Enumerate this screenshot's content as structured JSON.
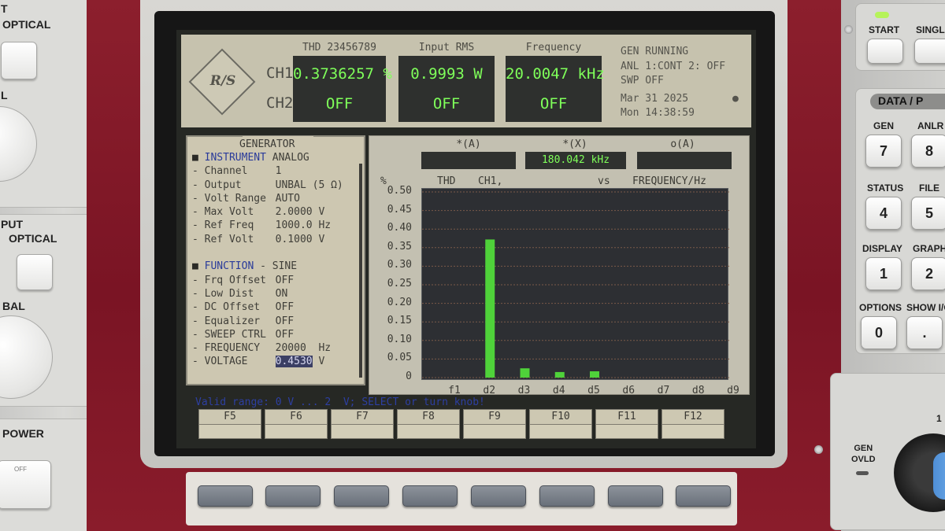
{
  "left_panel": {
    "top_label_partial": "T",
    "optical_label_1": "OPTICAL",
    "l_label": "L",
    "put_label": "PUT",
    "optical_label_2": "OPTICAL",
    "bal_label": "BAL",
    "power_label": "POWER",
    "off_label": "OFF"
  },
  "right_panel": {
    "start_label": "START",
    "single_label": "SINGLE",
    "data_label": "DATA / P",
    "keys": [
      {
        "label": "GEN",
        "digit": "7"
      },
      {
        "label": "ANLR",
        "digit": "8"
      },
      {
        "label": "STATUS",
        "digit": "4"
      },
      {
        "label": "FILE",
        "digit": "5"
      },
      {
        "label": "DISPLAY",
        "digit": "1"
      },
      {
        "label": "GRAPH",
        "digit": "2"
      }
    ],
    "options_label": "OPTIONS",
    "show_io_label": "SHOW I/O",
    "key_0": "0",
    "key_dot": ".",
    "gen_ovld_label": "GEN\nOVLD",
    "one_label": "1"
  },
  "header": {
    "ch1_label": "CH1",
    "ch2_label": "CH2",
    "measurements": [
      {
        "title": "THD 23456789",
        "ch1": "0.3736257 %",
        "ch2": "OFF"
      },
      {
        "title": "Input RMS",
        "ch1": "0.9993  W",
        "ch2": "OFF"
      },
      {
        "title": "Frequency",
        "ch1": "20.0047 kHz",
        "ch2": "OFF"
      }
    ],
    "status": {
      "line1": "GEN RUNNING",
      "line2": "ANL 1:CONT 2: OFF",
      "line3": "SWP OFF",
      "line4": "Mar 31 2025",
      "line5": "Mon 14:38:59",
      "indicator": "●"
    },
    "logo_text": "R/S"
  },
  "generator": {
    "title": "GENERATOR",
    "instrument_label": "INSTRUMENT",
    "instrument_value": "ANALOG",
    "rows1": [
      {
        "label": "Channel",
        "value": "1"
      },
      {
        "label": "Output",
        "value": "UNBAL (5 Ω)"
      },
      {
        "label": "Volt Range",
        "value": "AUTO"
      },
      {
        "label": "Max Volt",
        "value": "2.0000 V"
      },
      {
        "label": "Ref Freq",
        "value": "1000.0 Hz"
      },
      {
        "label": "Ref Volt",
        "value": "0.1000 V"
      }
    ],
    "function_label": "FUNCTION",
    "function_value": "- SINE",
    "rows2": [
      {
        "label": "Frq Offset",
        "value": "OFF"
      },
      {
        "label": "Low Dist",
        "value": "ON"
      },
      {
        "label": "DC Offset",
        "value": "OFF"
      },
      {
        "label": "Equalizer",
        "value": "OFF"
      },
      {
        "label": "SWEEP CTRL",
        "value": "OFF"
      },
      {
        "label": "FREQUENCY",
        "value": "20000  Hz"
      }
    ],
    "voltage_label": "VOLTAGE",
    "voltage_value": "0.4530",
    "voltage_unit": "V"
  },
  "graph": {
    "cursor_a_label": "*(A)",
    "cursor_x_label": "*(X)",
    "cursor_o_label": "o(A)",
    "cursor_a_value": "",
    "cursor_x_value": "180.042 kHz",
    "cursor_o_value": "",
    "unit_label": "%",
    "title_left": "THD",
    "title_ch": "CH1,",
    "title_vs": "vs",
    "title_right": "FREQUENCY/Hz"
  },
  "chart_data": {
    "type": "bar",
    "categories": [
      "f1",
      "d2",
      "d3",
      "d4",
      "d5",
      "d6",
      "d7",
      "d8",
      "d9"
    ],
    "values": [
      0,
      0.372,
      0.025,
      0.015,
      0.017,
      0,
      0,
      0,
      0
    ],
    "yticks": [
      "0.50",
      "0.45",
      "0.40",
      "0.35",
      "0.30",
      "0.25",
      "0.20",
      "0.15",
      "0.10",
      "0.05",
      "0"
    ],
    "ylim": [
      0,
      0.5
    ],
    "ylabel": "%",
    "grid": true,
    "bar_color": "#4fd23a",
    "cursor_category": "d9"
  },
  "status_bar": "Valid range: 0 V ... 2  V; SELECT or turn knob!",
  "fkeys": [
    "F5",
    "F6",
    "F7",
    "F8",
    "F9",
    "F10",
    "F11",
    "F12"
  ]
}
